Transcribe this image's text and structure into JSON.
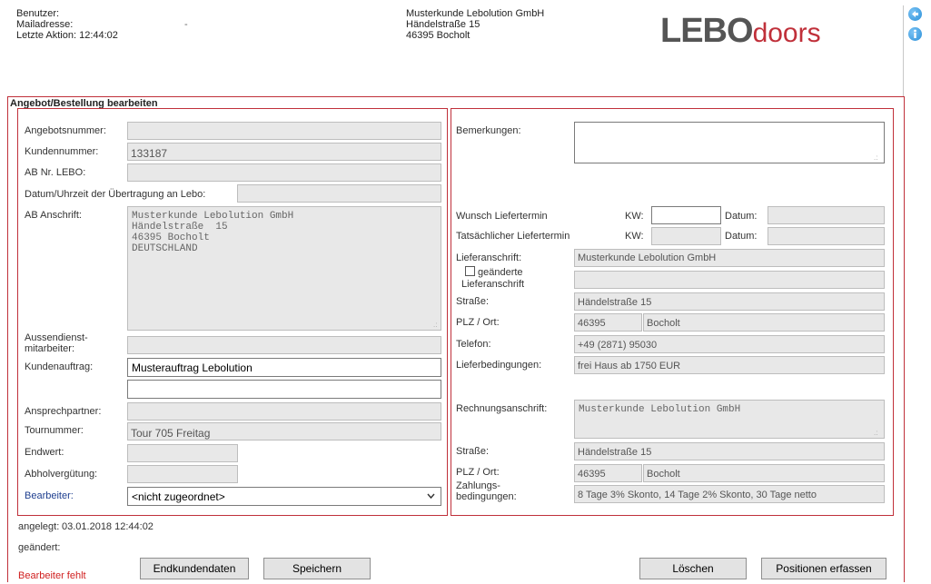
{
  "header": {
    "user_label": "Benutzer:",
    "mail_label": "Mailadresse:",
    "mail_value": "-",
    "last_action": "Letzte Aktion: 12:44:02",
    "company_name": "Musterkunde Lebolution GmbH",
    "company_street": "Händelstraße 15",
    "company_city": "46395 Bocholt",
    "logo_bold": "LEBO",
    "logo_light": "doors"
  },
  "section_title": "Angebot/Bestellung bearbeiten",
  "left": {
    "angebotsnummer_label": "Angebotsnummer:",
    "angebotsnummer_value": "",
    "kundennummer_label": "Kundennummer:",
    "kundennummer_value": "133187",
    "ab_nr_label": "AB Nr. LEBO:",
    "ab_nr_value": "",
    "datum_label": "Datum/Uhrzeit der Übertragung an Lebo:",
    "datum_value": "",
    "ab_anschrift_label": "AB Anschrift:",
    "ab_anschrift_value": "Musterkunde Lebolution GmbH\nHändelstraße  15\n46395 Bocholt\nDEUTSCHLAND",
    "aussendienst_label_1": "Aussendienst-",
    "aussendienst_label_2": "mitarbeiter:",
    "aussendienst_value": "",
    "kundenauftrag_label": "Kundenauftrag:",
    "kundenauftrag_value": "Musterauftrag Lebolution",
    "kundenauftrag_value_2": "",
    "ansprechpartner_label": "Ansprechpartner:",
    "ansprechpartner_value": "",
    "tournummer_label": "Tournummer:",
    "tournummer_value": "Tour 705 Freitag",
    "endwert_label": "Endwert:",
    "endwert_value": "",
    "abholverguetung_label": "Abholvergütung:",
    "abholverguetung_value": "",
    "bearbeiter_label": "Bearbeiter:",
    "bearbeiter_selected": "<nicht zugeordnet>"
  },
  "right": {
    "bemerkungen_label": "Bemerkungen:",
    "bemerkungen_value": "",
    "wunsch_label": "Wunsch Liefertermin",
    "tatsaechlich_label": "Tatsächlicher Liefertermin",
    "kw_label": "KW:",
    "datum_label": "Datum:",
    "wunsch_kw": "",
    "wunsch_datum": "",
    "tats_kw": "",
    "tats_datum": "",
    "lieferanschrift_label": "Lieferanschrift:",
    "lieferanschrift_value": "Musterkunde Lebolution GmbH",
    "lieferanschrift_value_2": "",
    "geaendert_label_1": "geänderte",
    "geaendert_label_2": "Lieferanschrift",
    "strasse_label": "Straße:",
    "strasse_value": "Händelstraße 15",
    "plz_label": "PLZ / Ort:",
    "plz_value": "46395",
    "ort_value": "Bocholt",
    "telefon_label": "Telefon:",
    "telefon_value": "+49 (2871) 95030",
    "lieferbedingungen_label": "Lieferbedingungen:",
    "lieferbedingungen_value": "frei Haus ab 1750 EUR",
    "rechnungsanschrift_label": "Rechnungsanschrift:",
    "rechnungsanschrift_value": "Musterkunde Lebolution GmbH",
    "r_strasse_label": "Straße:",
    "r_strasse_value": "Händelstraße 15",
    "r_plz_label": "PLZ / Ort:",
    "r_plz_value": "46395",
    "r_ort_value": "Bocholt",
    "zahlung_label_1": "Zahlungs-",
    "zahlung_label_2": "bedingungen:",
    "zahlung_value": "8 Tage 3% Skonto, 14 Tage 2% Skonto, 30 Tage netto"
  },
  "footer": {
    "angelegt_label": "angelegt:",
    "angelegt_value": "03.01.2018 12:44:02",
    "geaendert_label": "geändert:",
    "bearbeiter_fehlt": "Bearbeiter fehlt",
    "btn_endkundendaten": "Endkundendaten",
    "btn_speichern": "Speichern",
    "btn_loeschen": "Löschen",
    "btn_positionen": "Positionen erfassen"
  },
  "colors": {
    "frame_red": "#c0303a",
    "link_blue": "#1f3f8f",
    "error_red": "#d02020",
    "icon_blue": "#2a8fd8"
  },
  "icons": [
    "back-arrow-icon",
    "info-icon"
  ]
}
